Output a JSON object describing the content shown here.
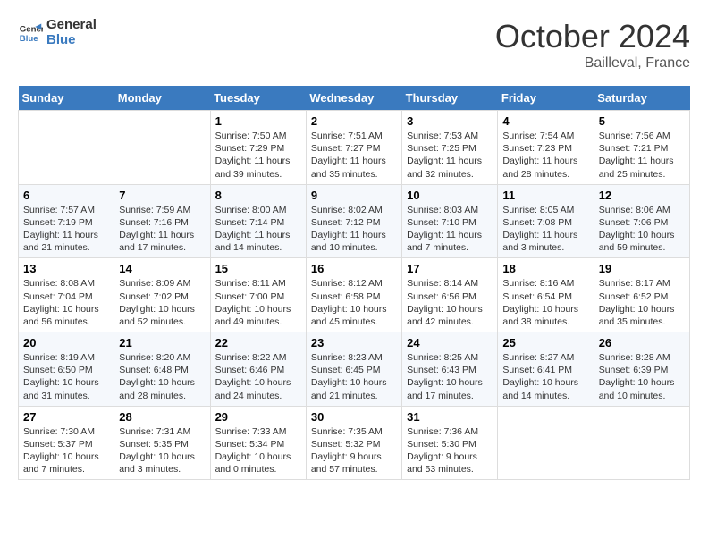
{
  "logo": {
    "line1": "General",
    "line2": "Blue"
  },
  "title": "October 2024",
  "location": "Bailleval, France",
  "headers": [
    "Sunday",
    "Monday",
    "Tuesday",
    "Wednesday",
    "Thursday",
    "Friday",
    "Saturday"
  ],
  "weeks": [
    [
      {
        "day": "",
        "sunrise": "",
        "sunset": "",
        "daylight": ""
      },
      {
        "day": "",
        "sunrise": "",
        "sunset": "",
        "daylight": ""
      },
      {
        "day": "1",
        "sunrise": "Sunrise: 7:50 AM",
        "sunset": "Sunset: 7:29 PM",
        "daylight": "Daylight: 11 hours and 39 minutes."
      },
      {
        "day": "2",
        "sunrise": "Sunrise: 7:51 AM",
        "sunset": "Sunset: 7:27 PM",
        "daylight": "Daylight: 11 hours and 35 minutes."
      },
      {
        "day": "3",
        "sunrise": "Sunrise: 7:53 AM",
        "sunset": "Sunset: 7:25 PM",
        "daylight": "Daylight: 11 hours and 32 minutes."
      },
      {
        "day": "4",
        "sunrise": "Sunrise: 7:54 AM",
        "sunset": "Sunset: 7:23 PM",
        "daylight": "Daylight: 11 hours and 28 minutes."
      },
      {
        "day": "5",
        "sunrise": "Sunrise: 7:56 AM",
        "sunset": "Sunset: 7:21 PM",
        "daylight": "Daylight: 11 hours and 25 minutes."
      }
    ],
    [
      {
        "day": "6",
        "sunrise": "Sunrise: 7:57 AM",
        "sunset": "Sunset: 7:19 PM",
        "daylight": "Daylight: 11 hours and 21 minutes."
      },
      {
        "day": "7",
        "sunrise": "Sunrise: 7:59 AM",
        "sunset": "Sunset: 7:16 PM",
        "daylight": "Daylight: 11 hours and 17 minutes."
      },
      {
        "day": "8",
        "sunrise": "Sunrise: 8:00 AM",
        "sunset": "Sunset: 7:14 PM",
        "daylight": "Daylight: 11 hours and 14 minutes."
      },
      {
        "day": "9",
        "sunrise": "Sunrise: 8:02 AM",
        "sunset": "Sunset: 7:12 PM",
        "daylight": "Daylight: 11 hours and 10 minutes."
      },
      {
        "day": "10",
        "sunrise": "Sunrise: 8:03 AM",
        "sunset": "Sunset: 7:10 PM",
        "daylight": "Daylight: 11 hours and 7 minutes."
      },
      {
        "day": "11",
        "sunrise": "Sunrise: 8:05 AM",
        "sunset": "Sunset: 7:08 PM",
        "daylight": "Daylight: 11 hours and 3 minutes."
      },
      {
        "day": "12",
        "sunrise": "Sunrise: 8:06 AM",
        "sunset": "Sunset: 7:06 PM",
        "daylight": "Daylight: 10 hours and 59 minutes."
      }
    ],
    [
      {
        "day": "13",
        "sunrise": "Sunrise: 8:08 AM",
        "sunset": "Sunset: 7:04 PM",
        "daylight": "Daylight: 10 hours and 56 minutes."
      },
      {
        "day": "14",
        "sunrise": "Sunrise: 8:09 AM",
        "sunset": "Sunset: 7:02 PM",
        "daylight": "Daylight: 10 hours and 52 minutes."
      },
      {
        "day": "15",
        "sunrise": "Sunrise: 8:11 AM",
        "sunset": "Sunset: 7:00 PM",
        "daylight": "Daylight: 10 hours and 49 minutes."
      },
      {
        "day": "16",
        "sunrise": "Sunrise: 8:12 AM",
        "sunset": "Sunset: 6:58 PM",
        "daylight": "Daylight: 10 hours and 45 minutes."
      },
      {
        "day": "17",
        "sunrise": "Sunrise: 8:14 AM",
        "sunset": "Sunset: 6:56 PM",
        "daylight": "Daylight: 10 hours and 42 minutes."
      },
      {
        "day": "18",
        "sunrise": "Sunrise: 8:16 AM",
        "sunset": "Sunset: 6:54 PM",
        "daylight": "Daylight: 10 hours and 38 minutes."
      },
      {
        "day": "19",
        "sunrise": "Sunrise: 8:17 AM",
        "sunset": "Sunset: 6:52 PM",
        "daylight": "Daylight: 10 hours and 35 minutes."
      }
    ],
    [
      {
        "day": "20",
        "sunrise": "Sunrise: 8:19 AM",
        "sunset": "Sunset: 6:50 PM",
        "daylight": "Daylight: 10 hours and 31 minutes."
      },
      {
        "day": "21",
        "sunrise": "Sunrise: 8:20 AM",
        "sunset": "Sunset: 6:48 PM",
        "daylight": "Daylight: 10 hours and 28 minutes."
      },
      {
        "day": "22",
        "sunrise": "Sunrise: 8:22 AM",
        "sunset": "Sunset: 6:46 PM",
        "daylight": "Daylight: 10 hours and 24 minutes."
      },
      {
        "day": "23",
        "sunrise": "Sunrise: 8:23 AM",
        "sunset": "Sunset: 6:45 PM",
        "daylight": "Daylight: 10 hours and 21 minutes."
      },
      {
        "day": "24",
        "sunrise": "Sunrise: 8:25 AM",
        "sunset": "Sunset: 6:43 PM",
        "daylight": "Daylight: 10 hours and 17 minutes."
      },
      {
        "day": "25",
        "sunrise": "Sunrise: 8:27 AM",
        "sunset": "Sunset: 6:41 PM",
        "daylight": "Daylight: 10 hours and 14 minutes."
      },
      {
        "day": "26",
        "sunrise": "Sunrise: 8:28 AM",
        "sunset": "Sunset: 6:39 PM",
        "daylight": "Daylight: 10 hours and 10 minutes."
      }
    ],
    [
      {
        "day": "27",
        "sunrise": "Sunrise: 7:30 AM",
        "sunset": "Sunset: 5:37 PM",
        "daylight": "Daylight: 10 hours and 7 minutes."
      },
      {
        "day": "28",
        "sunrise": "Sunrise: 7:31 AM",
        "sunset": "Sunset: 5:35 PM",
        "daylight": "Daylight: 10 hours and 3 minutes."
      },
      {
        "day": "29",
        "sunrise": "Sunrise: 7:33 AM",
        "sunset": "Sunset: 5:34 PM",
        "daylight": "Daylight: 10 hours and 0 minutes."
      },
      {
        "day": "30",
        "sunrise": "Sunrise: 7:35 AM",
        "sunset": "Sunset: 5:32 PM",
        "daylight": "Daylight: 9 hours and 57 minutes."
      },
      {
        "day": "31",
        "sunrise": "Sunrise: 7:36 AM",
        "sunset": "Sunset: 5:30 PM",
        "daylight": "Daylight: 9 hours and 53 minutes."
      },
      {
        "day": "",
        "sunrise": "",
        "sunset": "",
        "daylight": ""
      },
      {
        "day": "",
        "sunrise": "",
        "sunset": "",
        "daylight": ""
      }
    ]
  ]
}
